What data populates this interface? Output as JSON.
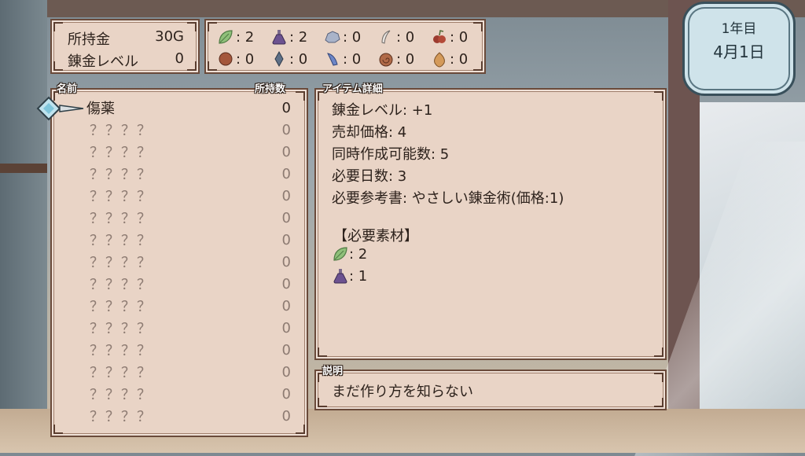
{
  "money": {
    "gold_label": "所持金",
    "gold_value": "30G",
    "level_label": "錬金レベル",
    "level_value": "0"
  },
  "materials": [
    {
      "icon": "leaf-icon",
      "value": ": 2"
    },
    {
      "icon": "potion-flask-icon",
      "value": ": 2"
    },
    {
      "icon": "ore-rock-icon",
      "value": ": 0"
    },
    {
      "icon": "feather-icon",
      "value": ": 0"
    },
    {
      "icon": "berries-icon",
      "value": ": 0"
    },
    {
      "icon": "mushroom-icon",
      "value": ": 0"
    },
    {
      "icon": "crystal-icon",
      "value": ": 0"
    },
    {
      "icon": "blue-slime-icon",
      "value": ": 0"
    },
    {
      "icon": "shell-icon",
      "value": ": 0"
    },
    {
      "icon": "nut-icon",
      "value": ": 0"
    }
  ],
  "date": {
    "year": "1年目",
    "day": "4月1日"
  },
  "list": {
    "name_header": "名前",
    "count_header": "所持数",
    "items": [
      {
        "name": "傷薬",
        "count": "0"
      },
      {
        "name": "？？？？",
        "count": "0"
      },
      {
        "name": "？？？？",
        "count": "0"
      },
      {
        "name": "？？？？",
        "count": "0"
      },
      {
        "name": "？？？？",
        "count": "0"
      },
      {
        "name": "？？？？",
        "count": "0"
      },
      {
        "name": "？？？？",
        "count": "0"
      },
      {
        "name": "？？？？",
        "count": "0"
      },
      {
        "name": "？？？？",
        "count": "0"
      },
      {
        "name": "？？？？",
        "count": "0"
      },
      {
        "name": "？？？？",
        "count": "0"
      },
      {
        "name": "？？？？",
        "count": "0"
      },
      {
        "name": "？？？？",
        "count": "0"
      },
      {
        "name": "？？？？",
        "count": "0"
      },
      {
        "name": "？？？？",
        "count": "0"
      }
    ]
  },
  "detail": {
    "header": "アイテム詳細",
    "lines": [
      "錬金レベル: +1",
      "売却価格: 4",
      "同時作成可能数: 5",
      "必要日数: 3",
      "必要参考書: やさしい錬金術(価格:1)"
    ],
    "materials_title": "【必要素材】",
    "required": [
      {
        "icon": "leaf-icon",
        "value": ": 2"
      },
      {
        "icon": "potion-flask-icon",
        "value": ": 1"
      }
    ]
  },
  "description": {
    "header": "説明",
    "text": "まだ作り方を知らない"
  },
  "colors": {
    "panel": "#e9d4c6",
    "border": "#6a4a3a",
    "locked_text": "#8d7b72",
    "badge": "#cfe3ea"
  }
}
